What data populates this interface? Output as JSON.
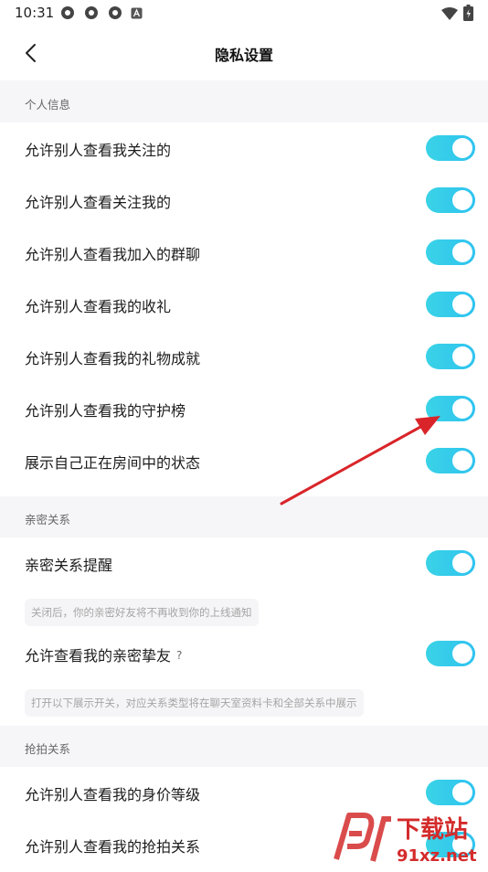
{
  "status_bar": {
    "time": "10:31"
  },
  "header": {
    "title": "隐私设置"
  },
  "sections": [
    {
      "title": "个人信息",
      "items": [
        {
          "label": "允许别人查看我关注的",
          "on": true
        },
        {
          "label": "允许别人查看关注我的",
          "on": true
        },
        {
          "label": "允许别人查看我加入的群聊",
          "on": true
        },
        {
          "label": "允许别人查看我的收礼",
          "on": true
        },
        {
          "label": "允许别人查看我的礼物成就",
          "on": true
        },
        {
          "label": "允许别人查看我的守护榜",
          "on": true
        },
        {
          "label": "展示自己正在房间中的状态",
          "on": true
        }
      ]
    },
    {
      "title": "亲密关系",
      "items": [
        {
          "label": "亲密关系提醒",
          "on": true,
          "note": "关闭后，你的亲密好友将不再收到你的上线通知"
        },
        {
          "label": "允许查看我的亲密挚友",
          "help": "?",
          "on": true,
          "note": "打开以下展示开关，对应关系类型将在聊天室资料卡和全部关系中展示"
        }
      ]
    },
    {
      "title": "抢拍关系",
      "items": [
        {
          "label": "允许别人查看我的身价等级",
          "on": true
        },
        {
          "label": "允许别人查看我的抢拍关系",
          "on": true
        }
      ]
    }
  ],
  "watermark": {
    "brand": "下载站",
    "site": "91xz.net"
  },
  "colors": {
    "toggle_on": "#33cbea",
    "section_bg": "#f6f6f8",
    "arrow": "#d9252a"
  }
}
